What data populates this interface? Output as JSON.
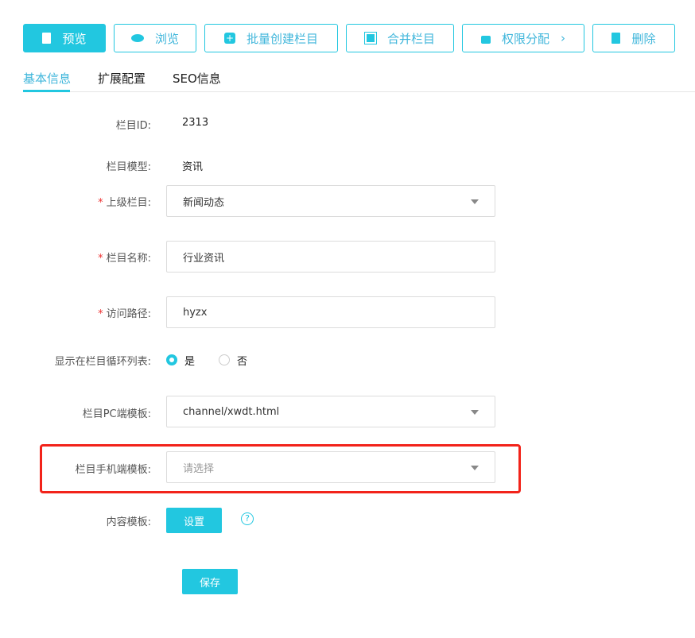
{
  "toolbar": {
    "preview": "预览",
    "browse": "浏览",
    "batch_create": "批量创建栏目",
    "merge": "合并栏目",
    "permissions": "权限分配",
    "delete": "删除"
  },
  "tabs": [
    "基本信息",
    "扩展配置",
    "SEO信息"
  ],
  "form": {
    "id_label": "栏目ID:",
    "id_value": "2313",
    "model_label": "栏目模型:",
    "model_value": "资讯",
    "parent_label": "上级栏目:",
    "parent_value": "新闻动态",
    "name_label": "栏目名称:",
    "name_value": "行业资讯",
    "path_label": "访问路径:",
    "path_value": "hyzx",
    "show_label": "显示在栏目循环列表:",
    "show_yes": "是",
    "show_no": "否",
    "pc_label": "栏目PC端模板:",
    "pc_value": "channel/xwdt.html",
    "mobile_label": "栏目手机端模板:",
    "mobile_placeholder": "请选择",
    "content_label": "内容模板:",
    "content_button": "设置",
    "help": "?",
    "required_mark": "*",
    "save": "保存"
  }
}
